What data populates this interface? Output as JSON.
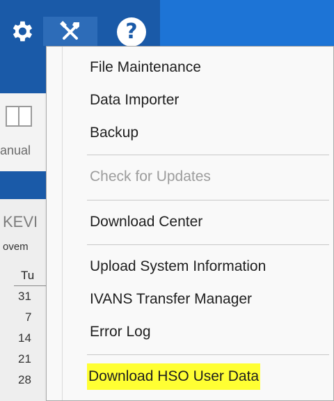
{
  "toolbar": {
    "help_label": "?",
    "icons": [
      "gear-icon",
      "tools-icon",
      "help-icon"
    ],
    "color": "#1a5aa8"
  },
  "ribbon": {
    "manual_label": "anual"
  },
  "calendar": {
    "name": "KEVI",
    "month": "ovem",
    "day_header": "Tu",
    "dates": [
      "31",
      "7",
      "14",
      "21",
      "28"
    ]
  },
  "menu": {
    "items": [
      {
        "label": "File Maintenance",
        "enabled": true
      },
      {
        "label": "Data Importer",
        "enabled": true
      },
      {
        "label": "Backup",
        "enabled": true
      },
      {
        "label": "Check for Updates",
        "enabled": false
      },
      {
        "label": "Download Center",
        "enabled": true
      },
      {
        "label": "Upload System Information",
        "enabled": true
      },
      {
        "label": "IVANS Transfer Manager",
        "enabled": true
      },
      {
        "label": "Error Log",
        "enabled": true
      },
      {
        "label": "Download HSO User Data",
        "enabled": true,
        "highlighted": true
      }
    ],
    "highlight_color": "#ffff33"
  }
}
